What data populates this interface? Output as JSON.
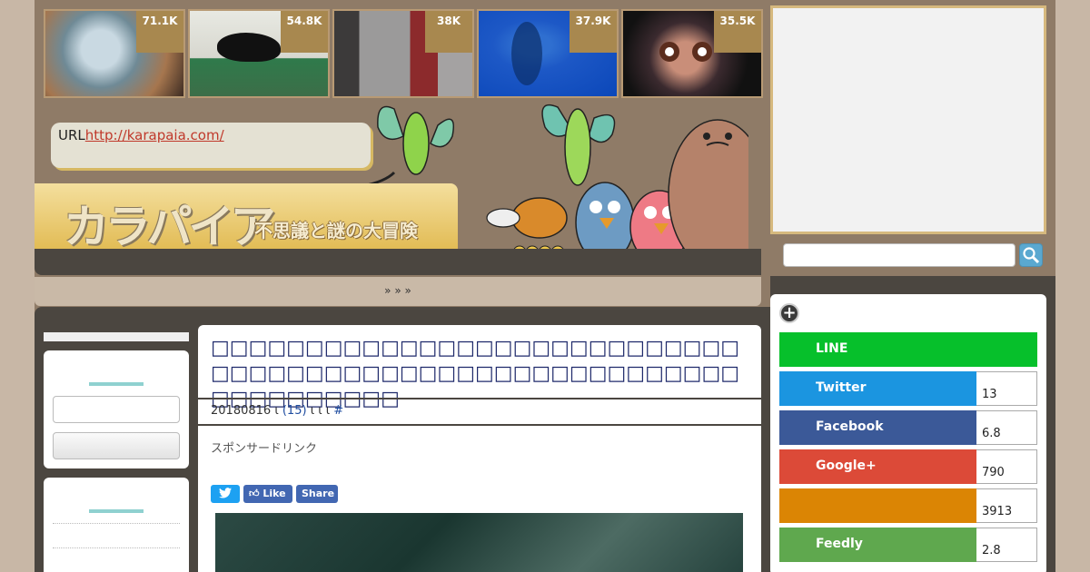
{
  "thumbs": [
    {
      "count": "71.1K"
    },
    {
      "count": "54.8K"
    },
    {
      "count": "38K"
    },
    {
      "count": "37.9K"
    },
    {
      "count": "35.5K"
    }
  ],
  "url_box": {
    "prefix": "URL",
    "link": "http://karapaia.com/"
  },
  "logo": {
    "title": "カラパイア",
    "subtitle": "不思議と謎の大冒険"
  },
  "breadcrumb": "» » »",
  "article": {
    "title": "□□□□□□□□□□□□□□□□□□□□□□□□□□□□□□□□□□□□□□□□□□□□□□□□□□□□□□□□□□□□□□□□□□",
    "date": "20180816",
    "sep1": "ι",
    "comments": "(15)",
    "tags": "ι ι ι",
    "hash": "#",
    "sponsor": "スポンサードリンク",
    "share_like": "Like",
    "share_share": "Share"
  },
  "share": {
    "line": {
      "label": "LINE",
      "color": "#06c02b"
    },
    "twitter": {
      "label": "Twitter",
      "count": "13",
      "color": "#1b95e0"
    },
    "facebook": {
      "label": "Facebook",
      "count": "6.8",
      "color": "#3b5998"
    },
    "google": {
      "label": "Google+",
      "count": "790",
      "color": "#dc4a38"
    },
    "hatena": {
      "label": "",
      "count": "3913",
      "color": "#db8504"
    },
    "feedly": {
      "label": "Feedly",
      "count": "2.8",
      "color": "#5fa84e"
    }
  }
}
